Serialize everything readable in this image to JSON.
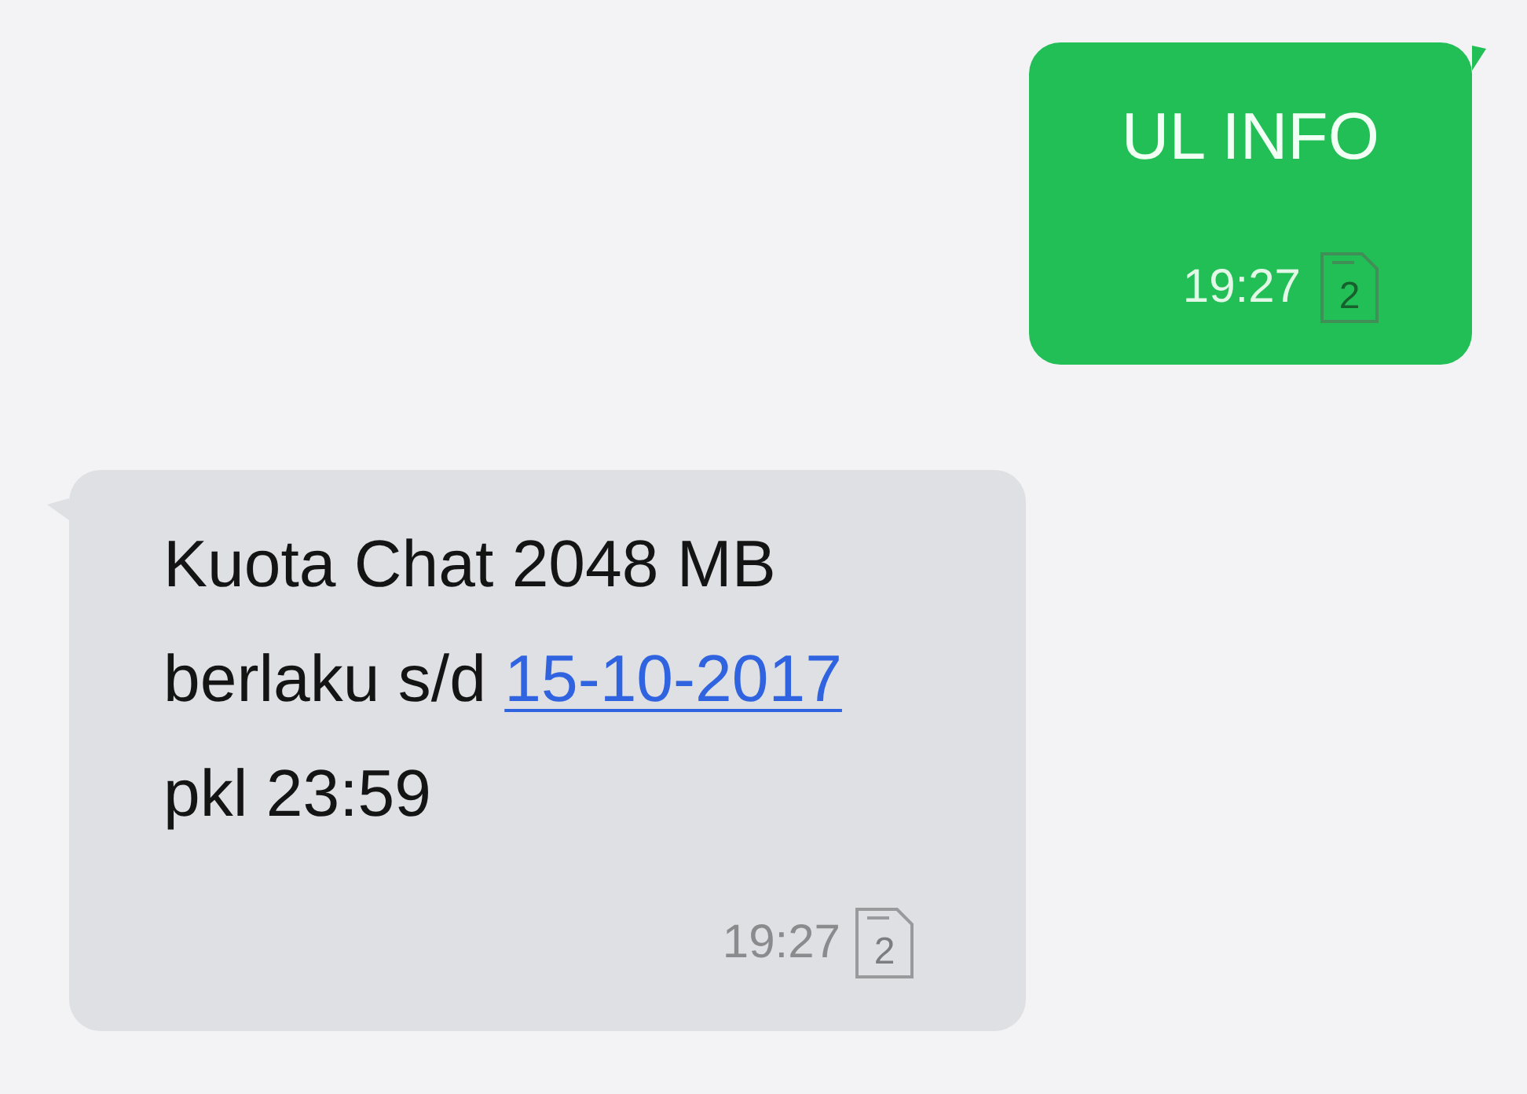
{
  "messages": [
    {
      "kind": "sent",
      "lines": [
        {
          "parts": [
            {
              "kind": "text",
              "text": "UL INFO"
            }
          ]
        }
      ],
      "time": "19:27",
      "sim": "2"
    },
    {
      "kind": "received",
      "lines": [
        {
          "parts": [
            {
              "kind": "text",
              "text": "Kuota Chat 2048 MB"
            }
          ]
        },
        {
          "parts": [
            {
              "kind": "text",
              "text": "berlaku s/d "
            },
            {
              "kind": "link",
              "text": "15-10-2017"
            }
          ]
        },
        {
          "parts": [
            {
              "kind": "text",
              "text": "pkl 23:59"
            }
          ]
        }
      ],
      "time": "19:27",
      "sim": "2"
    }
  ]
}
